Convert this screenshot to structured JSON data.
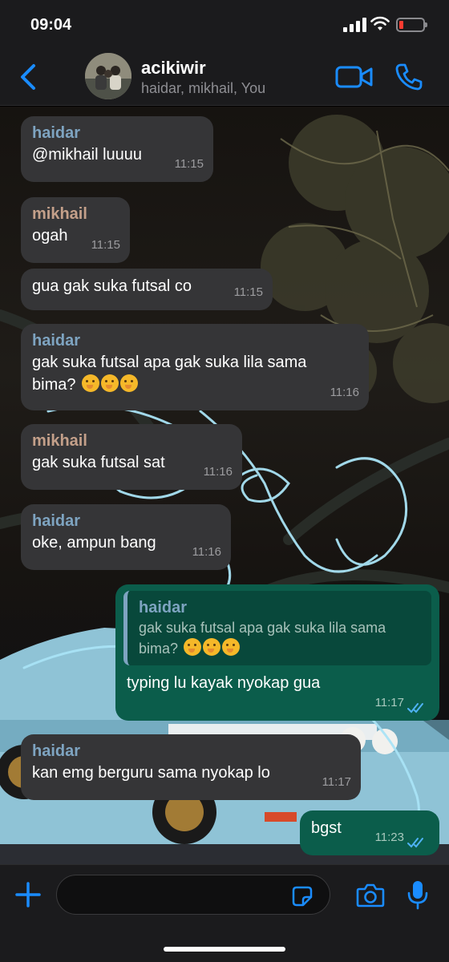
{
  "status": {
    "time": "09:04"
  },
  "header": {
    "group_name": "acikiwir",
    "members": "haidar, mikhail, You"
  },
  "icons": {
    "back": "chevron-left-icon",
    "video": "video-call-icon",
    "phone": "phone-icon",
    "plus": "plus-icon",
    "sticker": "sticker-icon",
    "camera": "camera-icon",
    "mic": "microphone-icon"
  },
  "colors": {
    "accent": "#1a8cff",
    "incoming": "#353537",
    "outgoing": "#0b5d4b"
  },
  "messages": [
    {
      "sender": "haidar",
      "text": "@mikhail luuuu",
      "time": "11:15"
    },
    {
      "sender": "mikhail",
      "text": "ogah",
      "time": "11:15"
    },
    {
      "text": "gua gak suka futsal co",
      "time": "11:15"
    },
    {
      "sender": "haidar",
      "text_line1": "gak suka futsal apa gak suka lila sama",
      "text_line2": "bima?",
      "time": "11:16"
    },
    {
      "sender": "mikhail",
      "text": "gak suka futsal sat",
      "time": "11:16"
    },
    {
      "sender": "haidar",
      "text": "oke, ampun bang",
      "time": "11:16"
    },
    {
      "quote_sender": "haidar",
      "quote_line1": "gak suka futsal apa gak suka lila sama",
      "quote_line2": "bima?",
      "text": "typing lu kayak nyokap gua",
      "time": "11:17"
    },
    {
      "sender": "haidar",
      "text": "kan emg berguru sama nyokap lo",
      "time": "11:17"
    },
    {
      "text": "bgst",
      "time": "11:23"
    }
  ]
}
